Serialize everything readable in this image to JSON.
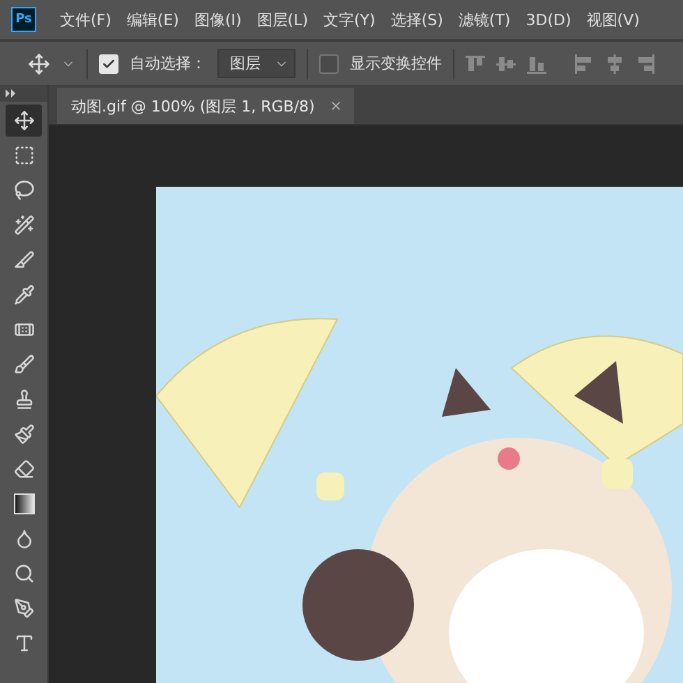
{
  "app_logo": "Ps",
  "menu": [
    "文件(F)",
    "编辑(E)",
    "图像(I)",
    "图层(L)",
    "文字(Y)",
    "选择(S)",
    "滤镜(T)",
    "3D(D)",
    "视图(V)"
  ],
  "options_bar": {
    "auto_select": {
      "label": "自动选择：",
      "checked": true
    },
    "target": {
      "value": "图层"
    },
    "show_transform": {
      "label": "显示变换控件",
      "checked": false
    },
    "align_buttons": [
      {
        "kind": "top"
      },
      {
        "kind": "vcenter"
      },
      {
        "kind": "bottom"
      },
      {
        "kind": "left"
      },
      {
        "kind": "hcenter"
      },
      {
        "kind": "right"
      }
    ]
  },
  "document_tabs": [
    {
      "title": "动图.gif @ 100% (图层 1, RGB/8)",
      "selected": true
    }
  ],
  "tools": [
    {
      "kind": "move",
      "selected": true
    },
    {
      "kind": "marquee",
      "selected": false
    },
    {
      "kind": "lasso",
      "selected": false
    },
    {
      "kind": "quick",
      "selected": false
    },
    {
      "kind": "slice",
      "selected": false
    },
    {
      "kind": "eyedropper",
      "selected": false
    },
    {
      "kind": "heal",
      "selected": false
    },
    {
      "kind": "brush",
      "selected": false
    },
    {
      "kind": "stamp",
      "selected": false
    },
    {
      "kind": "history",
      "selected": false
    },
    {
      "kind": "eraser",
      "selected": false
    },
    {
      "kind": "gradient",
      "selected": false
    },
    {
      "kind": "blur",
      "selected": false
    },
    {
      "kind": "dodge",
      "selected": false
    },
    {
      "kind": "pen",
      "selected": false
    },
    {
      "kind": "type",
      "selected": false
    }
  ]
}
